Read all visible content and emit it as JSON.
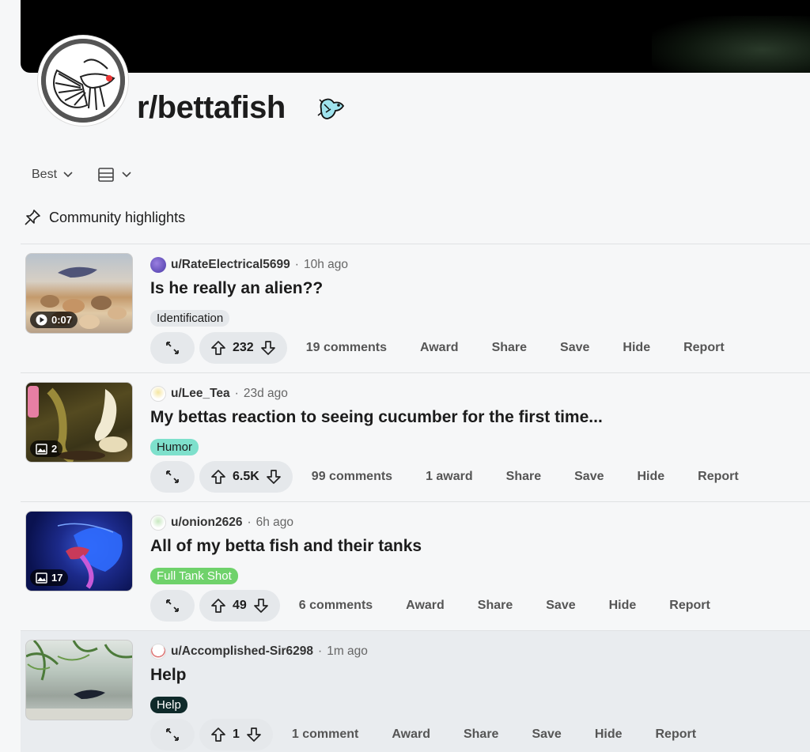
{
  "subreddit": {
    "name": "r/bettafish"
  },
  "toolbar": {
    "sort_label": "Best"
  },
  "highlights": {
    "label": "Community highlights"
  },
  "posts": [
    {
      "user": "u/RateElectrical5699",
      "time": "10h ago",
      "title": "Is he really an alien??",
      "flair": "Identification",
      "flair_bg": "#e5e8eb",
      "flair_fg": "#1c1c1c",
      "thumb_badge": "0:07",
      "votes": "232",
      "comments": "19 comments",
      "award": "Award",
      "share": "Share",
      "save": "Save",
      "hide": "Hide",
      "report": "Report"
    },
    {
      "user": "u/Lee_Tea",
      "time": "23d ago",
      "title": "My bettas reaction to seeing cucumber for the first time...",
      "flair": "Humor",
      "flair_bg": "#7ee0cc",
      "flair_fg": "#1c1c1c",
      "thumb_badge": "2",
      "votes": "6.5K",
      "comments": "99 comments",
      "award": "1 award",
      "share": "Share",
      "save": "Save",
      "hide": "Hide",
      "report": "Report"
    },
    {
      "user": "u/onion2626",
      "time": "6h ago",
      "title": "All of my betta fish and their tanks",
      "flair": "Full Tank Shot",
      "flair_bg": "#6fd26b",
      "flair_fg": "#ffffff",
      "thumb_badge": "17",
      "votes": "49",
      "comments": "6 comments",
      "award": "Award",
      "share": "Share",
      "save": "Save",
      "hide": "Hide",
      "report": "Report"
    },
    {
      "user": "u/Accomplished-Sir6298",
      "time": "1m ago",
      "title": "Help",
      "flair": "Help",
      "flair_bg": "#0f2a2a",
      "flair_fg": "#ffffff",
      "votes": "1",
      "comments": "1 comment",
      "award": "Award",
      "share": "Share",
      "save": "Save",
      "hide": "Hide",
      "report": "Report"
    }
  ]
}
